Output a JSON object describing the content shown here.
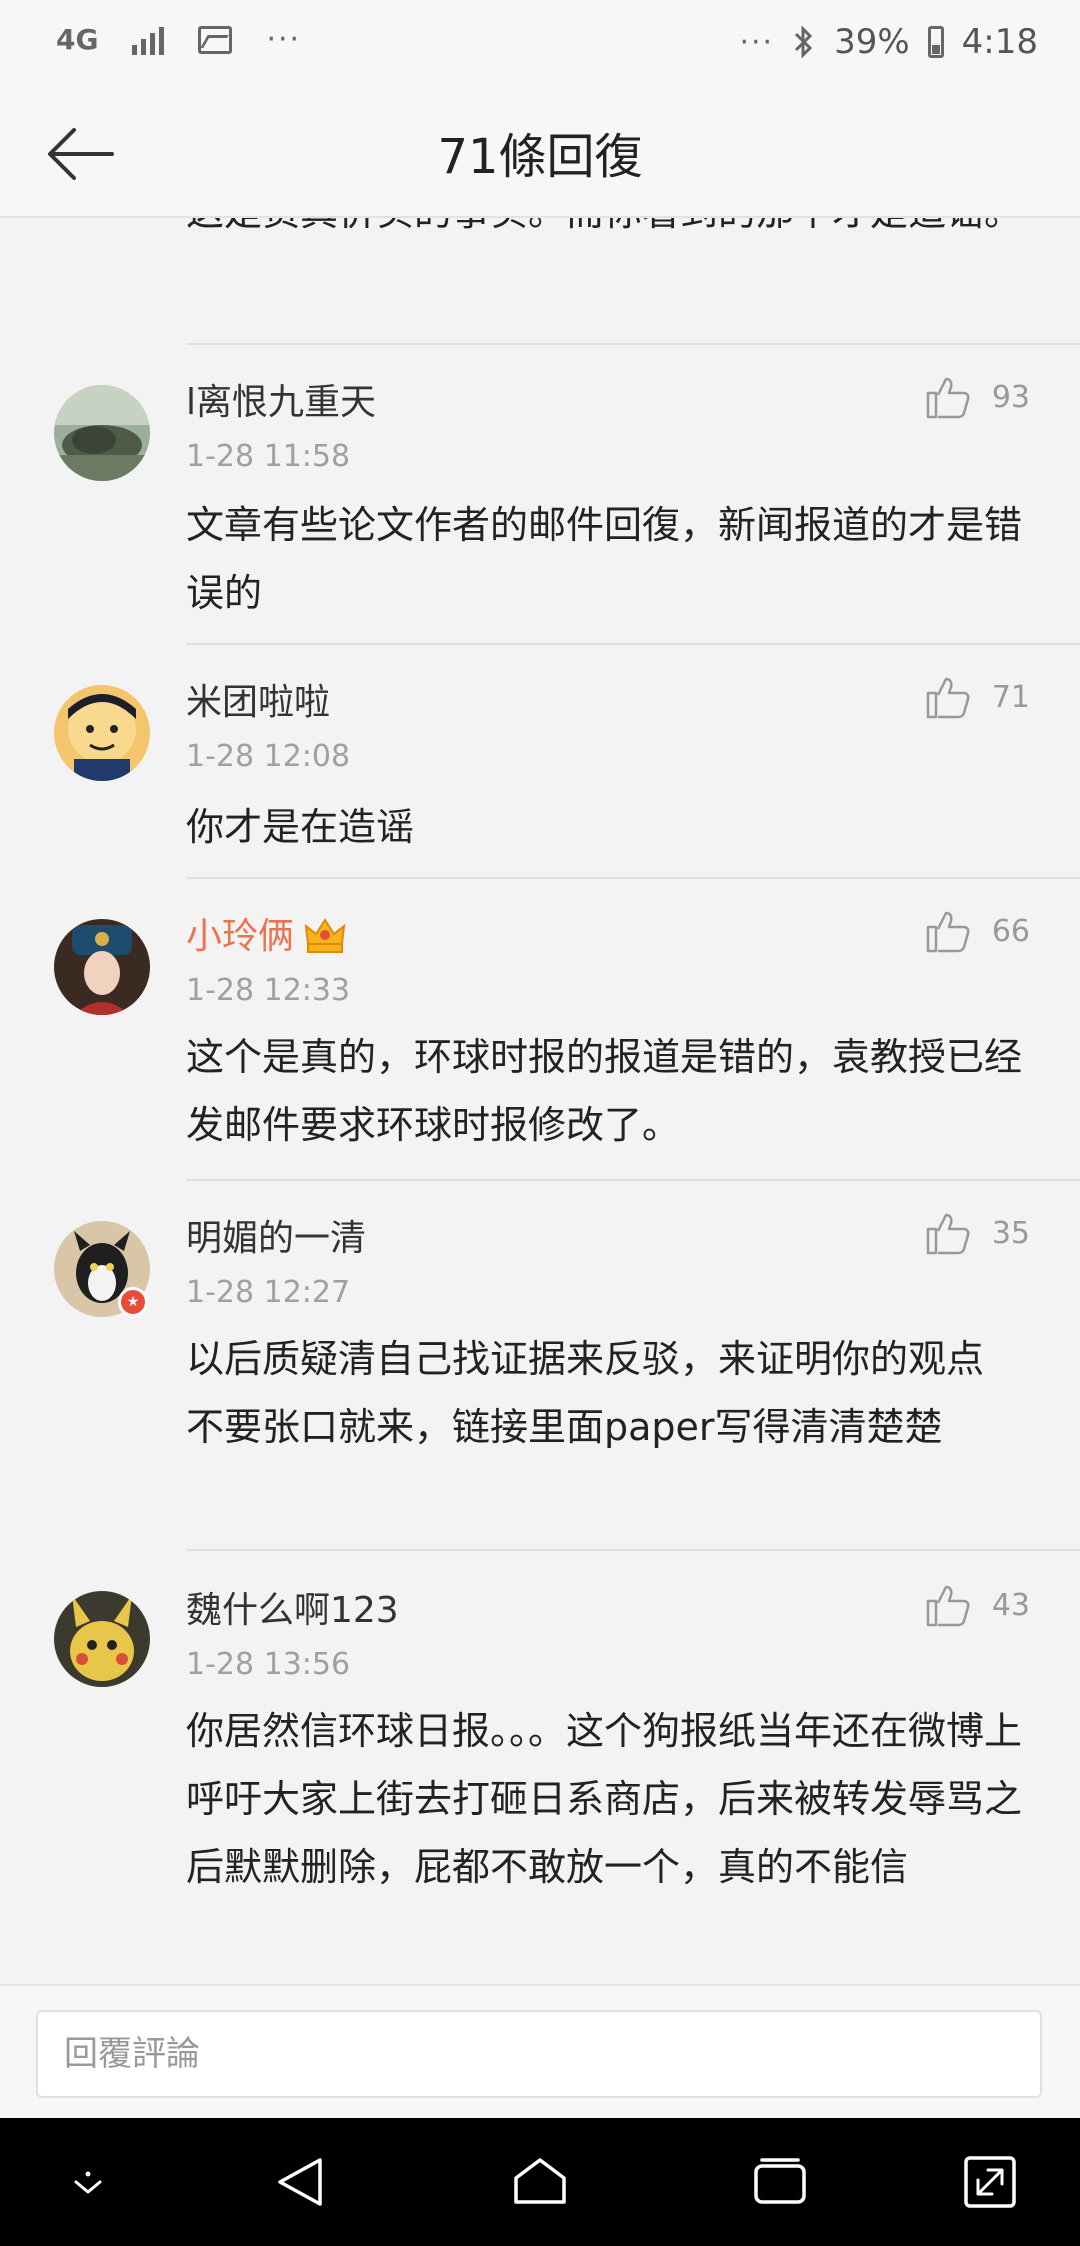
{
  "status_bar": {
    "network": "4G",
    "battery": "39%",
    "time": "4:18",
    "left_more": "···",
    "right_more": "···"
  },
  "header": {
    "title": "71條回復",
    "back_icon": "arrow-left-icon"
  },
  "partial_comment": {
    "text": "这是货真价实的事实。而你看到的那个才是造谣。"
  },
  "comments": [
    {
      "username": "l离恨九重天",
      "time": "1-28 11:58",
      "likes": "93",
      "text": "文章有些论文作者的邮件回復，新闻报道的才是错误的",
      "vip": false
    },
    {
      "username": "米团啦啦",
      "time": "1-28 12:08",
      "likes": "71",
      "text": "你才是在造谣",
      "vip": false
    },
    {
      "username": "小玲俩",
      "time": "1-28 12:33",
      "likes": "66",
      "text": "这个是真的，环球时报的报道是错的，袁教授已经发邮件要求环球时报修改了。",
      "vip": true
    },
    {
      "username": "明媚的一清",
      "time": "1-28 12:27",
      "likes": "35",
      "text": "以后质疑清自己找证据来反驳，来证明你的观点 不要张口就来，链接里面paper写得清清楚楚",
      "vip": false
    },
    {
      "username": "魏什么啊123",
      "time": "1-28 13:56",
      "likes": "43",
      "text": "你居然信环球日报。。。这个狗报纸当年还在微博上呼吁大家上街去打砸日系商店，后来被转发辱骂之后默默删除，屁都不敢放一个，真的不能信",
      "vip": false
    }
  ],
  "reply": {
    "placeholder": "回覆評論"
  },
  "colors": {
    "vip_name": "#eb7350",
    "background": "#f3f3f3"
  }
}
